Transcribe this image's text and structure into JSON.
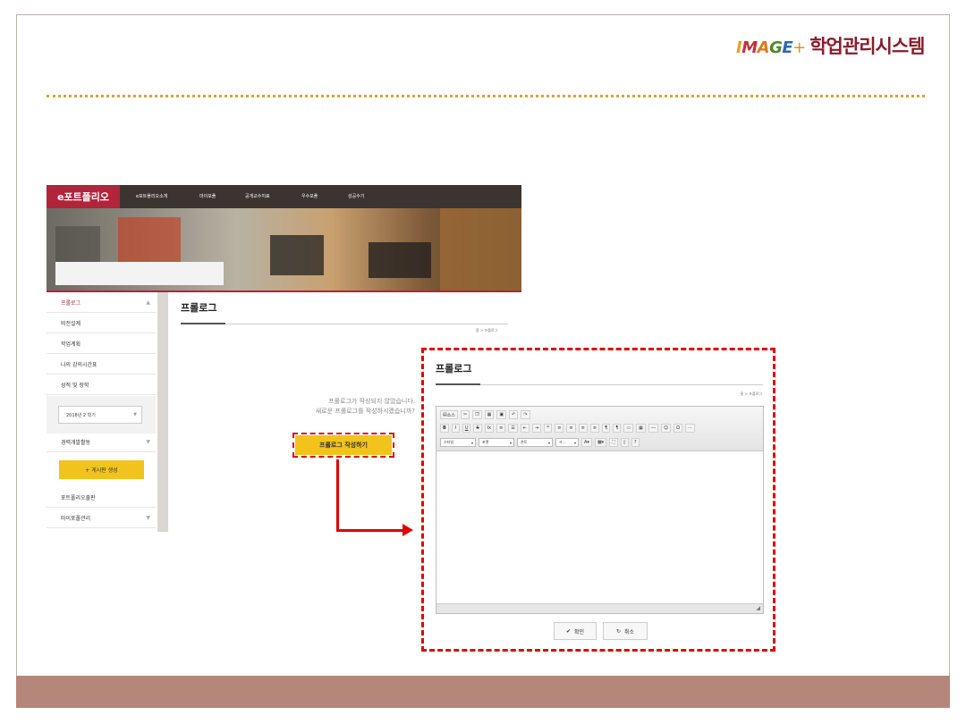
{
  "logo": {
    "brand": "IMAGE",
    "plus": "+",
    "title": "학업관리시스템"
  },
  "site": {
    "brand": "e포트폴리오",
    "nav": [
      "e포트폴리오소개",
      "마이포폴",
      "공개교수지료",
      "우수포폴",
      "성공수기"
    ]
  },
  "sidebar": {
    "items": [
      "프롤로그",
      "비전설계",
      "학업계획",
      "나의 강의시간표",
      "성적 및 장학"
    ],
    "semester": "2018년 2 학기",
    "career": "경력개발활동",
    "board_button": "+ 게시판 생성",
    "items2": [
      "포트폴리오출판",
      "마이포폴관리"
    ]
  },
  "content": {
    "title": "프롤로그",
    "breadcrumb": "홈 > 프롤로그",
    "message_line1": "프롤로그가 작성되지 않았습니다.",
    "message_line2": "새로운 프롤로그를 작성하시겠습니까?",
    "write_button": "프롤로그 작성하기"
  },
  "popup": {
    "title": "프롤로그",
    "breadcrumb": "홈 > 프롤로그",
    "toolbar": {
      "row1": [
        "소스"
      ],
      "row2": [
        "B",
        "I",
        "U",
        "S",
        "Ix",
        "??"
      ],
      "selects": [
        "스타일",
        "포맷",
        "폰트",
        "크..."
      ]
    },
    "ok_button": "확인",
    "cancel_button": "취소"
  },
  "colors": {
    "accent": "#b1243a",
    "highlight": "#f2c31c",
    "annotation": "#e00000",
    "footer": "#b5877a"
  }
}
